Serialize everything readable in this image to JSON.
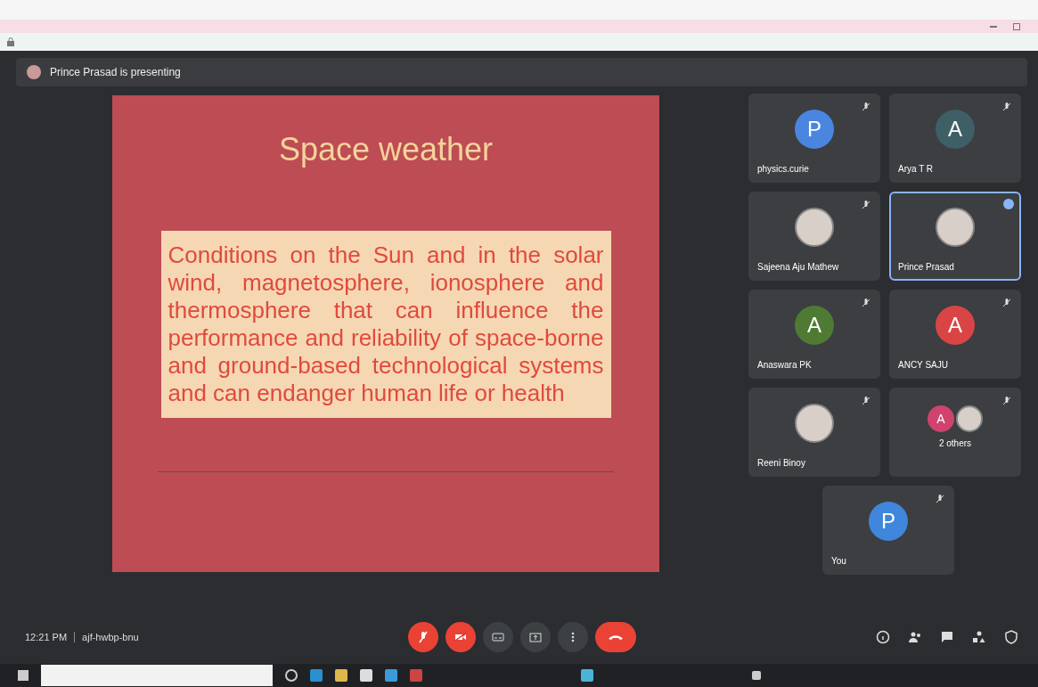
{
  "presenting_bar": {
    "text": "Prince Prasad is presenting"
  },
  "slide": {
    "title": "Space weather",
    "body": "Conditions on the Sun and in the solar wind, magnetosphere, ionosphere and thermosphere that can influence the performance and reliability of space-borne and ground-based technological systems and can endanger human life or health"
  },
  "participants": [
    {
      "name": "physics.curie",
      "kind": "letter",
      "initial": "P",
      "color": "#4a86e0",
      "active": false
    },
    {
      "name": "Arya T R",
      "kind": "letter",
      "initial": "A",
      "color": "#3e5f66",
      "active": false
    },
    {
      "name": "Sajeena Aju Mathew",
      "kind": "photo",
      "active": false
    },
    {
      "name": "Prince Prasad",
      "kind": "photo",
      "active": true
    },
    {
      "name": "Anaswara PK",
      "kind": "letter",
      "initial": "A",
      "color": "#4f7a33",
      "active": false
    },
    {
      "name": "ANCY SAJU",
      "kind": "letter",
      "initial": "A",
      "color": "#d94545",
      "active": false
    },
    {
      "name": "Reeni Binoy",
      "kind": "photo",
      "active": false
    },
    {
      "name": "2 others",
      "kind": "group",
      "initial": "A",
      "color": "#d0436f",
      "active": false
    },
    {
      "name": "You",
      "kind": "letter",
      "initial": "P",
      "color": "#3f86dc",
      "active": false
    }
  ],
  "meeting_info": {
    "time": "12:21 PM",
    "code": "ajf-hwbp-bnu"
  },
  "controls": [
    {
      "kind": "mic",
      "on": false
    },
    {
      "kind": "camera",
      "on": false
    },
    {
      "kind": "captions",
      "on": false
    },
    {
      "kind": "present",
      "on": false
    },
    {
      "kind": "more",
      "on": false
    },
    {
      "kind": "end"
    }
  ]
}
